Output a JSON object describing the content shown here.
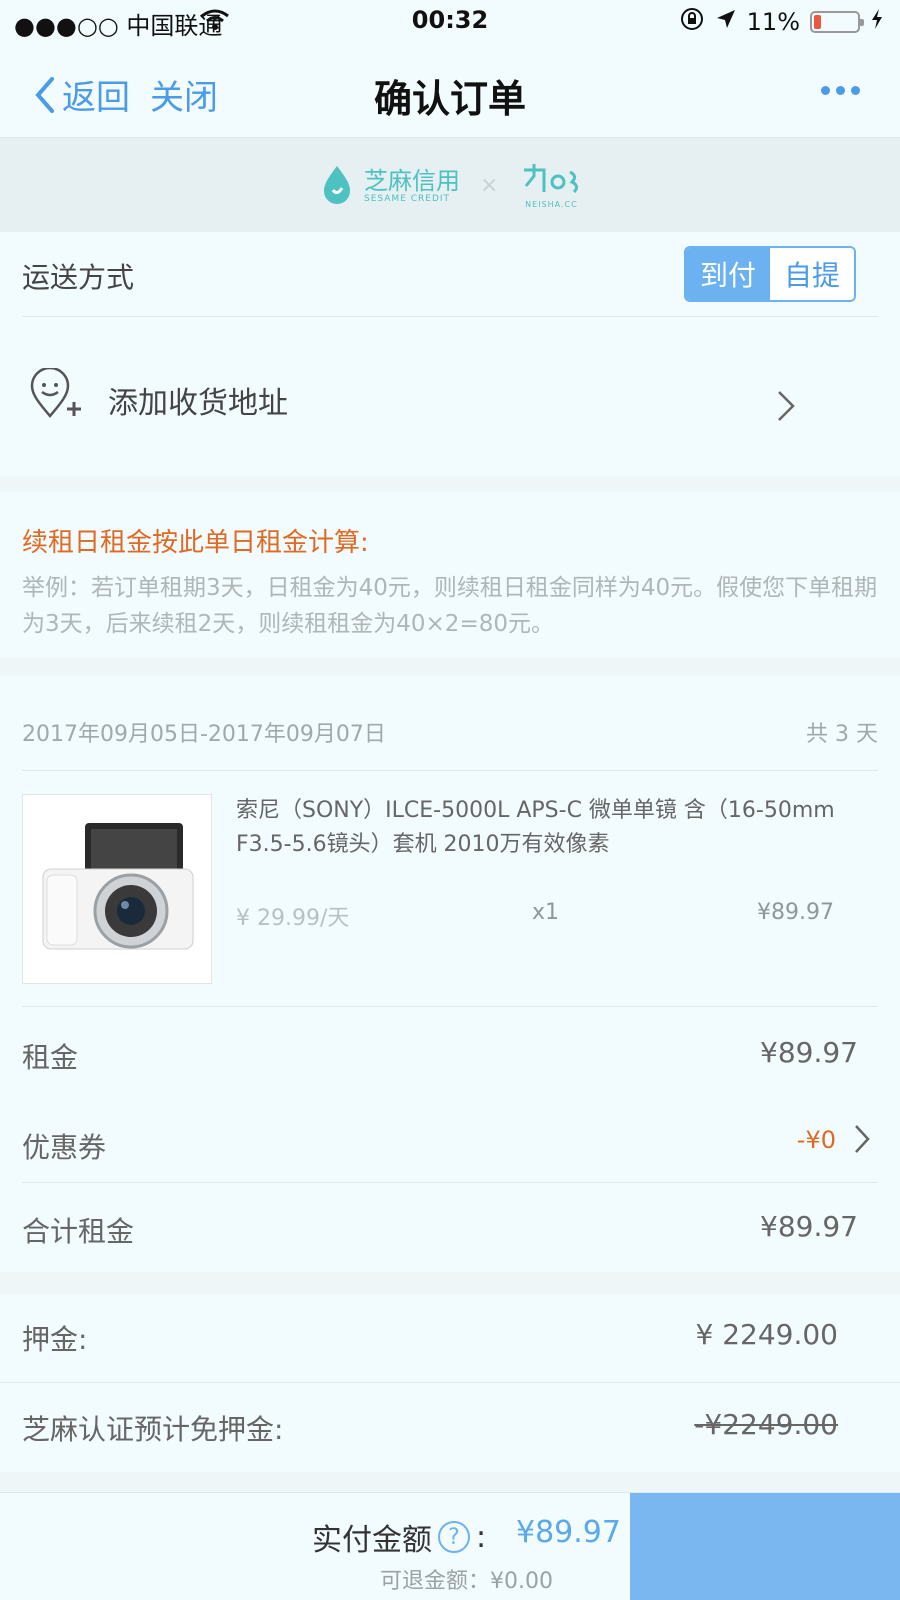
{
  "status_bar": {
    "carrier": "●●●○○ 中国联通",
    "time": "00:32",
    "battery_percent": "11%"
  },
  "nav": {
    "back_label": "返回",
    "close_label": "关闭",
    "title": "确认订单"
  },
  "banner": {
    "sesame_cn": "芝麻信用",
    "sesame_en": "SESAME CREDIT",
    "neisha_en": "NEISHA.CC"
  },
  "delivery": {
    "label": "运送方式",
    "options": [
      "到付",
      "自提"
    ],
    "selected": "到付"
  },
  "address": {
    "label": "添加收货地址"
  },
  "tip": {
    "title": "续租日租金按此单日租金计算:",
    "body": "举例：若订单租期3天，日租金为40元，则续租日租金同样为40元。假使您下单租期为3天，后来续租2天，则续租租金为40×2=80元。"
  },
  "rental": {
    "date_range": "2017年09月05日-2017年09月07日",
    "days": "共 3 天"
  },
  "product": {
    "name": "索尼（SONY）ILCE-5000L APS-C 微单单镜 含（16-50mm F3.5-5.6镜头）套机 2010万有效像素",
    "unit_price": "¥ 29.99/天",
    "quantity": "x1",
    "total": "¥89.97"
  },
  "summary": {
    "rent_label": "租金",
    "rent_value": "¥89.97",
    "coupon_label": "优惠券",
    "coupon_value": "-¥0",
    "total_label": "合计租金",
    "total_value": "¥89.97"
  },
  "deposit": {
    "label": "押金:",
    "value": "¥ 2249.00",
    "waiver_label": "芝麻认证预计免押金:",
    "waiver_value": "-¥2249.00"
  },
  "footer": {
    "pay_label": "实付金额",
    "pay_colon": ":",
    "pay_value": "¥89.97",
    "refund_text": "可退金额：¥0.00"
  },
  "colors": {
    "accent": "#6cb2f0",
    "link": "#4b9be8",
    "warning": "#e06a24",
    "background": "#f2fbfd"
  },
  "icons": [
    "chevron-left-icon",
    "more-dots-icon",
    "location-add-icon",
    "chevron-right-icon",
    "question-icon",
    "wifi-icon",
    "lock-rotation-icon",
    "location-arrow-icon",
    "battery-icon"
  ]
}
